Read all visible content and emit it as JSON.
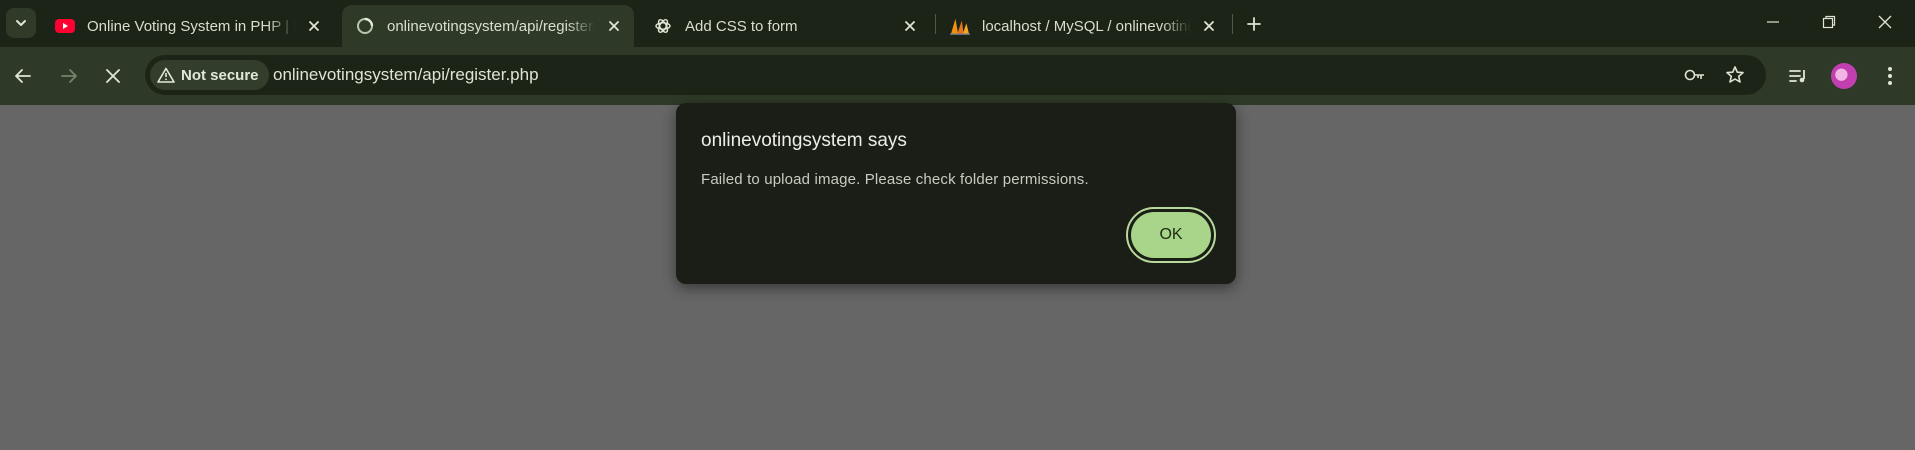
{
  "tabs": [
    {
      "title": "Online Voting System in PHP | P",
      "favicon": "youtube-icon",
      "active": false
    },
    {
      "title": "onlinevotingsystem/api/register.php",
      "favicon": "loading-icon",
      "active": true
    },
    {
      "title": "Add CSS to form",
      "favicon": "chatgpt-icon",
      "active": false
    },
    {
      "title": "localhost / MySQL / onlinevoting",
      "favicon": "phpmyadmin-icon",
      "active": false
    }
  ],
  "toolbar": {
    "security_label": "Not secure",
    "url": "onlinevotingsystem/api/register.php"
  },
  "dialog": {
    "title": "onlinevotingsystem says",
    "message": "Failed to upload image. Please check folder permissions.",
    "ok_label": "OK"
  },
  "colors": {
    "tabstrip": "#1c2417",
    "toolbar": "#2e3a27",
    "page": "#666666",
    "dialog": "#1a1e16",
    "ok_button": "#a9d58b"
  }
}
